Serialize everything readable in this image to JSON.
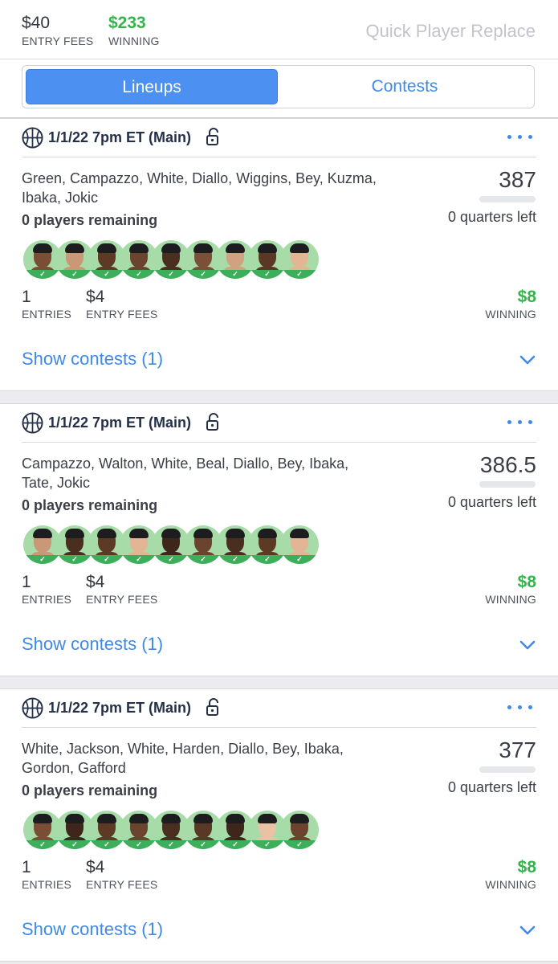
{
  "summary": {
    "entry_fees_value": "$40",
    "entry_fees_label": "ENTRY FEES",
    "winning_value": "$233",
    "winning_label": "WINNING",
    "quick_replace": "Quick Player Replace"
  },
  "tabs": {
    "lineups": "Lineups",
    "contests": "Contests",
    "active": "lineups"
  },
  "colors": {
    "accent": "#4c90f2",
    "green": "#37b24d",
    "avatar_bg": "#a7dca9"
  },
  "lineups": [
    {
      "date": "1/1/22 7pm ET (Main)",
      "players_line1": "Green, Campazzo, White, Diallo, Wiggins, Bey, Kuzma,",
      "players_line2": "Ibaka, Jokic",
      "remaining": "0 players remaining",
      "score": "387",
      "quarters_left": "0 quarters left",
      "entries_value": "1",
      "entries_label": "ENTRIES",
      "fees_value": "$4",
      "fees_label": "ENTRY FEES",
      "winning_value": "$8",
      "winning_label": "WINNING",
      "show_contests": "Show contests (1)",
      "avatar_count": 9
    },
    {
      "date": "1/1/22 7pm ET (Main)",
      "players_line1": "Campazzo, Walton, White, Beal, Diallo, Bey, Ibaka,",
      "players_line2": "Tate, Jokic",
      "remaining": "0 players remaining",
      "score": "386.5",
      "quarters_left": "0 quarters left",
      "entries_value": "1",
      "entries_label": "ENTRIES",
      "fees_value": "$4",
      "fees_label": "ENTRY FEES",
      "winning_value": "$8",
      "winning_label": "WINNING",
      "show_contests": "Show contests (1)",
      "avatar_count": 9
    },
    {
      "date": "1/1/22 7pm ET (Main)",
      "players_line1": "White, Jackson, White, Harden, Diallo, Bey, Ibaka,",
      "players_line2": "Gordon, Gafford",
      "remaining": "0 players remaining",
      "score": "377",
      "quarters_left": "0 quarters left",
      "entries_value": "1",
      "entries_label": "ENTRIES",
      "fees_value": "$4",
      "fees_label": "ENTRY FEES",
      "winning_value": "$8",
      "winning_label": "WINNING",
      "show_contests": "Show contests (1)",
      "avatar_count": 9
    }
  ]
}
